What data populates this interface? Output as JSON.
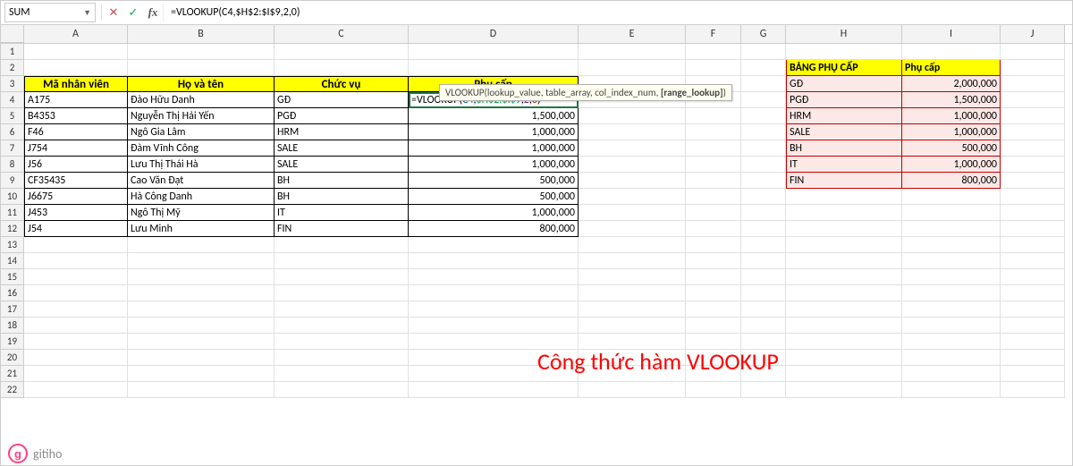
{
  "namebox": "SUM",
  "formula": "=VLOOKUP(C4,$H$2:$I$9,2,0)",
  "formula_tokens": {
    "fn": "=VLOOKUP(",
    "a1": "C4",
    "a2": "$H$2:$I$9",
    "a3": "2",
    "a4": "0"
  },
  "tooltip": {
    "fn": "VLOOKUP(",
    "p1": "lookup_value",
    "p2": "table_array",
    "p3": "col_index_num",
    "p4": "[range_lookup]"
  },
  "columns": [
    "A",
    "B",
    "C",
    "D",
    "E",
    "F",
    "G",
    "H",
    "I",
    "J"
  ],
  "headers": {
    "A": "Mã nhân viên",
    "B": "Họ và tên",
    "C": "Chức vụ",
    "D": "Phụ cấp"
  },
  "main": [
    {
      "id": "A175",
      "name": "Đào Hữu Danh",
      "role": "GĐ",
      "pay": ""
    },
    {
      "id": "B4353",
      "name": "Nguyễn Thị Hải Yến",
      "role": "PGĐ",
      "pay": "1,500,000"
    },
    {
      "id": "F46",
      "name": "Ngô Gia Lâm",
      "role": "HRM",
      "pay": "1,000,000"
    },
    {
      "id": "J754",
      "name": "Đàm Vĩnh Công",
      "role": "SALE",
      "pay": "1,000,000"
    },
    {
      "id": "J56",
      "name": "Lưu Thị Thái Hà",
      "role": "SALE",
      "pay": "1,000,000"
    },
    {
      "id": "CF35435",
      "name": "Cao Văn Đạt",
      "role": "BH",
      "pay": "500,000"
    },
    {
      "id": "J6675",
      "name": "Hà Công Danh",
      "role": "BH",
      "pay": "500,000"
    },
    {
      "id": "J453",
      "name": "Ngô Thị Mỹ",
      "role": "IT",
      "pay": "1,000,000"
    },
    {
      "id": "J54",
      "name": "Lưu Minh",
      "role": "FIN",
      "pay": "800,000"
    }
  ],
  "lookup_title": {
    "l": "BẢNG PHỤ CẤP",
    "r": "Phụ cấp"
  },
  "lookup": [
    {
      "k": "GĐ",
      "v": "2,000,000"
    },
    {
      "k": "PGĐ",
      "v": "1,500,000"
    },
    {
      "k": "HRM",
      "v": "1,000,000"
    },
    {
      "k": "SALE",
      "v": "1,000,000"
    },
    {
      "k": "BH",
      "v": "500,000"
    },
    {
      "k": "IT",
      "v": "1,000,000"
    },
    {
      "k": "FIN",
      "v": "800,000"
    }
  ],
  "annotation": "Công thức hàm VLOOKUP",
  "footer": {
    "logo": "g",
    "name": "gitiho"
  },
  "rowcount": 22
}
